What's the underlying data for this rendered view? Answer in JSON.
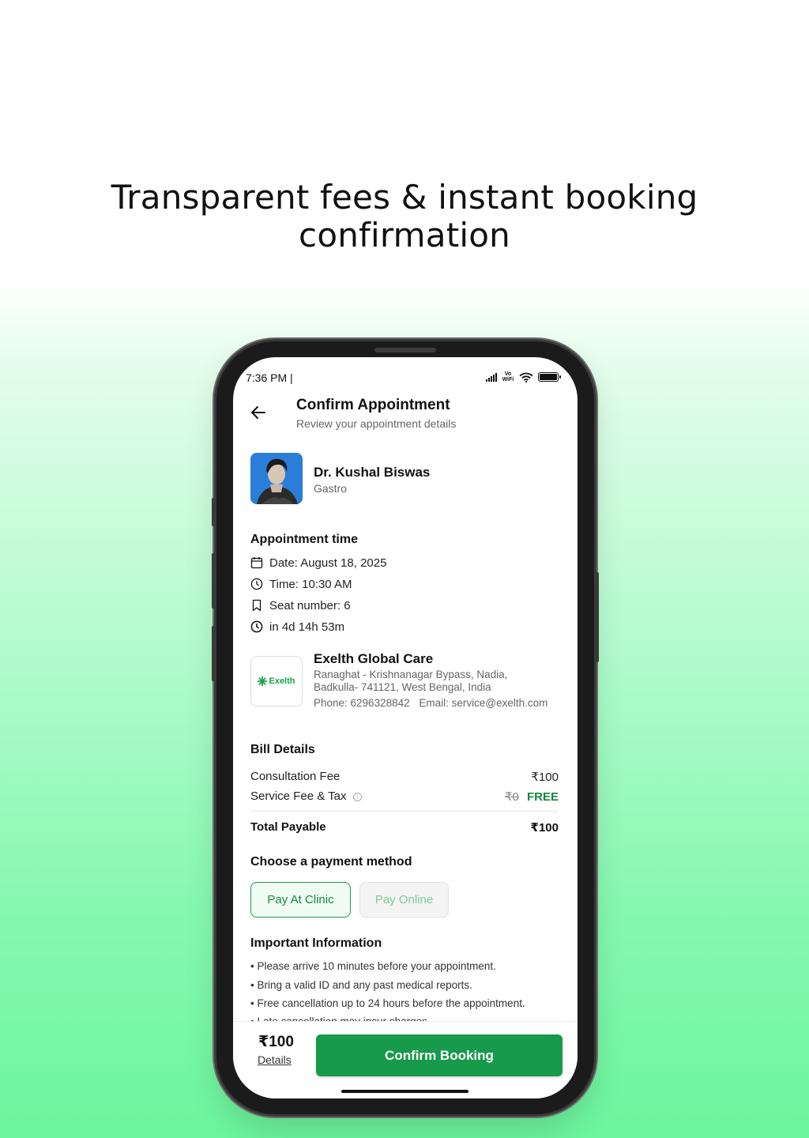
{
  "headline": {
    "line1": "Transparent fees & instant booking",
    "line2": "confirmation"
  },
  "status_bar": {
    "time": "7:36 PM |",
    "network_label": "Vo WiFi"
  },
  "header": {
    "title": "Confirm Appointment",
    "subtitle": "Review your appointment details"
  },
  "doctor": {
    "name": "Dr. Kushal Biswas",
    "specialty": "Gastro"
  },
  "appointment": {
    "heading": "Appointment time",
    "date": "Date: August 18, 2025",
    "time": "Time: 10:30 AM",
    "seat": "Seat number: 6",
    "countdown": "in 4d 14h 53m"
  },
  "clinic": {
    "logo_text": "Exelth",
    "name": "Exelth Global Care",
    "address": "Ranaghat - Krishnanagar Bypass, Nadia, Badkulla- 741121, West Bengal, India",
    "phone": "Phone: 6296328842",
    "email": "Email: service@exelth.com"
  },
  "bill": {
    "heading": "Bill Details",
    "consultation_label": "Consultation Fee",
    "consultation_value": "₹100",
    "service_label": "Service Fee & Tax",
    "service_original": "₹0",
    "service_value": "FREE",
    "total_label": "Total Payable",
    "total_value": "₹100"
  },
  "payment": {
    "heading": "Choose a payment method",
    "options": [
      "Pay At Clinic",
      "Pay Online"
    ],
    "selected": "Pay At Clinic"
  },
  "info": {
    "heading": "Important Information",
    "items": [
      "• Please arrive 10 minutes before your appointment.",
      "• Bring a valid ID and any past medical reports.",
      "• Free cancellation up to 24 hours before the appointment.",
      "• Late cancellation may incur charges."
    ]
  },
  "footer": {
    "price": "₹100",
    "details_label": "Details",
    "confirm_label": "Confirm Booking"
  },
  "colors": {
    "accent_green": "#179a4a",
    "free_green": "#17873f",
    "avatar_bg": "#2a7ed9"
  },
  "icons": [
    "back-arrow-icon",
    "calendar-icon",
    "clock-icon",
    "bookmark-icon",
    "info-icon",
    "signal-icon",
    "wifi-icon",
    "battery-icon"
  ]
}
